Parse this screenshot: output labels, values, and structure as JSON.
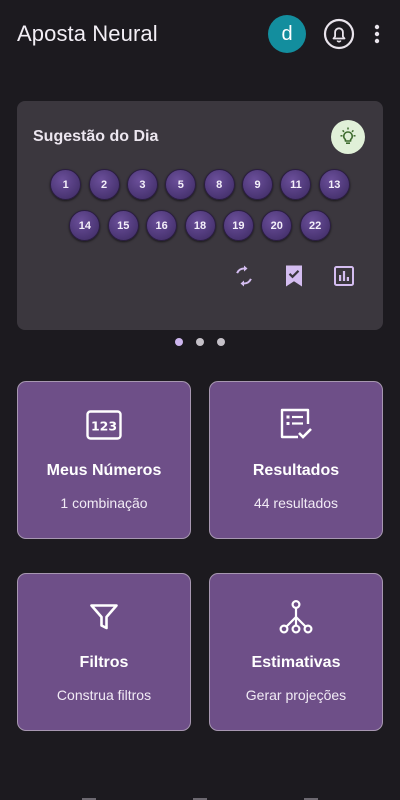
{
  "app": {
    "title": "Aposta Neural"
  },
  "header": {
    "avatar_initial": "d",
    "bell_icon": "bell-icon",
    "more_icon": "more-vert-icon"
  },
  "suggestion": {
    "title": "Sugestão do Dia",
    "bulb_icon": "lightbulb-icon",
    "numbers": [
      "1",
      "2",
      "3",
      "5",
      "8",
      "9",
      "11",
      "13",
      "14",
      "15",
      "16",
      "18",
      "19",
      "20",
      "22"
    ],
    "actions": [
      "refresh-icon",
      "bookmark-check-icon",
      "bar-chart-icon"
    ]
  },
  "carousel": {
    "pages": 3,
    "active_index": 0
  },
  "tiles": [
    {
      "label": "Meus Números",
      "subtitle": "1 combinação",
      "icon": "numbers-123-icon"
    },
    {
      "label": "Resultados",
      "subtitle": "44 resultados",
      "icon": "checklist-icon"
    },
    {
      "label": "Filtros",
      "subtitle": "Construa filtros",
      "icon": "filter-icon"
    },
    {
      "label": "Estimativas",
      "subtitle": "Gerar projeções",
      "icon": "tree-diagram-icon"
    }
  ],
  "colors": {
    "background": "#1c1a1f",
    "card": "#3b373e",
    "tile": "#6e4f88",
    "ball": "#4e3878",
    "accent": "#cdb6ee",
    "avatar": "#138e9e"
  }
}
